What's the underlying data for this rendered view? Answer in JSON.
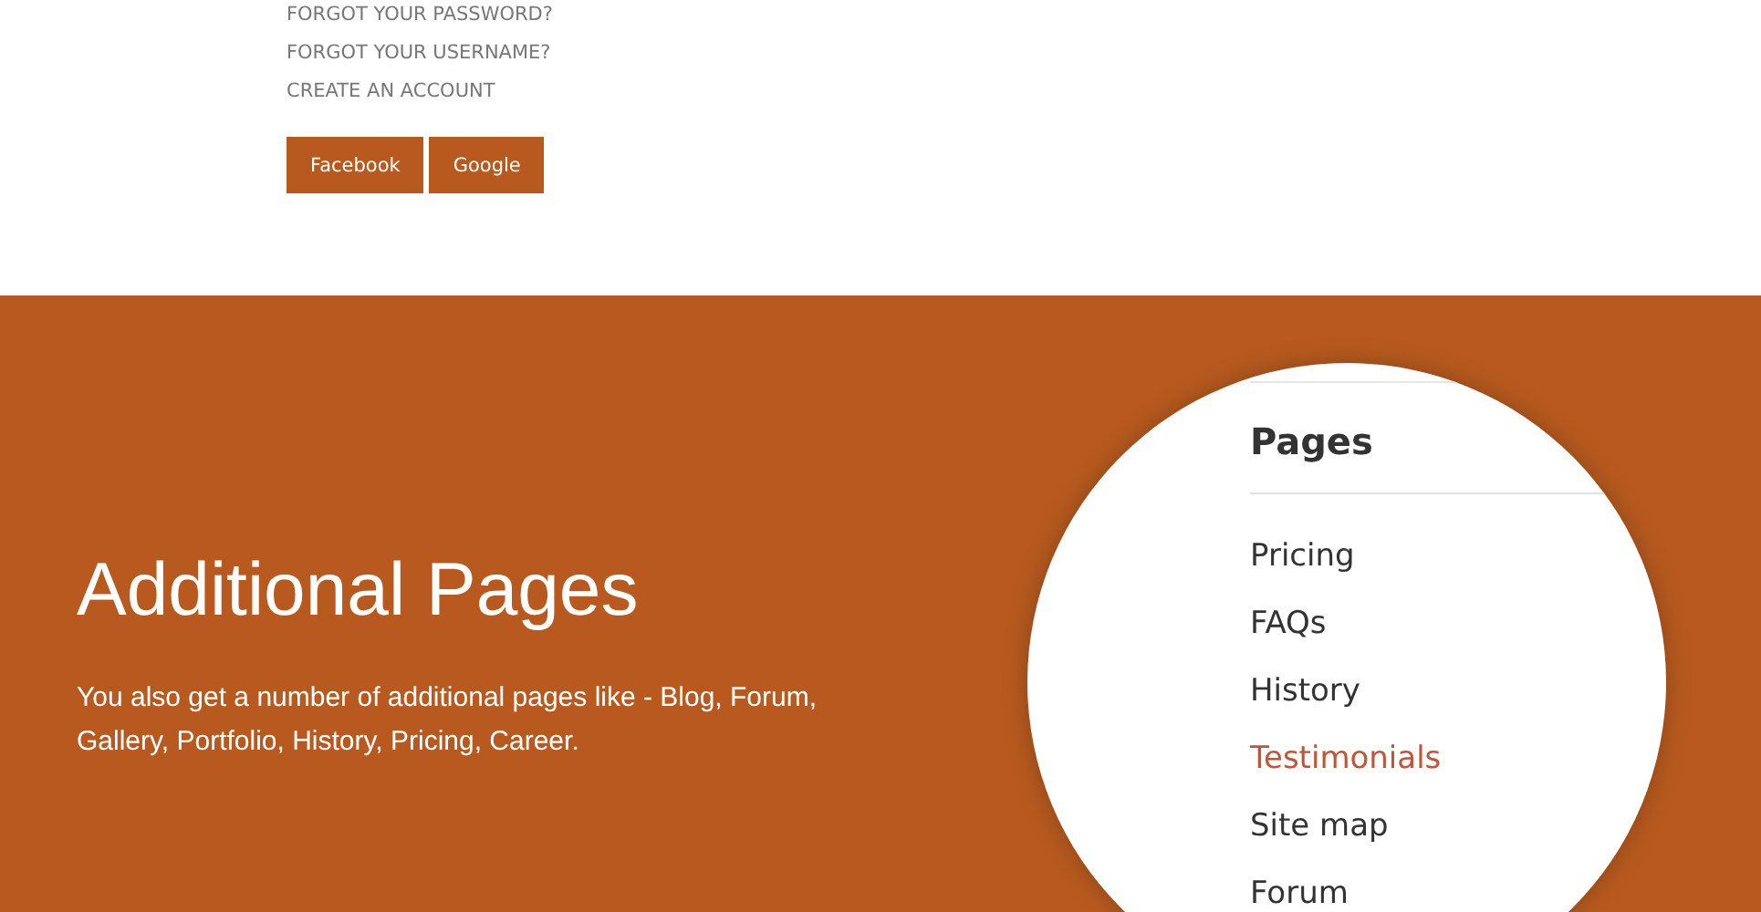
{
  "account_links": [
    "FORGOT YOUR PASSWORD?",
    "FORGOT YOUR USERNAME?",
    "CREATE AN ACCOUNT"
  ],
  "social_buttons": [
    "Facebook",
    "Google"
  ],
  "feature": {
    "title": "Additional Pages",
    "description": "You also get a number of additional pages like - Blog, Forum, Gallery, Portfolio, History, Pricing, Career."
  },
  "pages_menu": {
    "title": "Pages",
    "items": [
      {
        "label": "Pricing",
        "selected": false
      },
      {
        "label": "FAQs",
        "selected": false
      },
      {
        "label": "History",
        "selected": false
      },
      {
        "label": "Testimonials",
        "selected": true
      },
      {
        "label": "Site map",
        "selected": false
      },
      {
        "label": "Forum",
        "selected": false
      }
    ]
  }
}
